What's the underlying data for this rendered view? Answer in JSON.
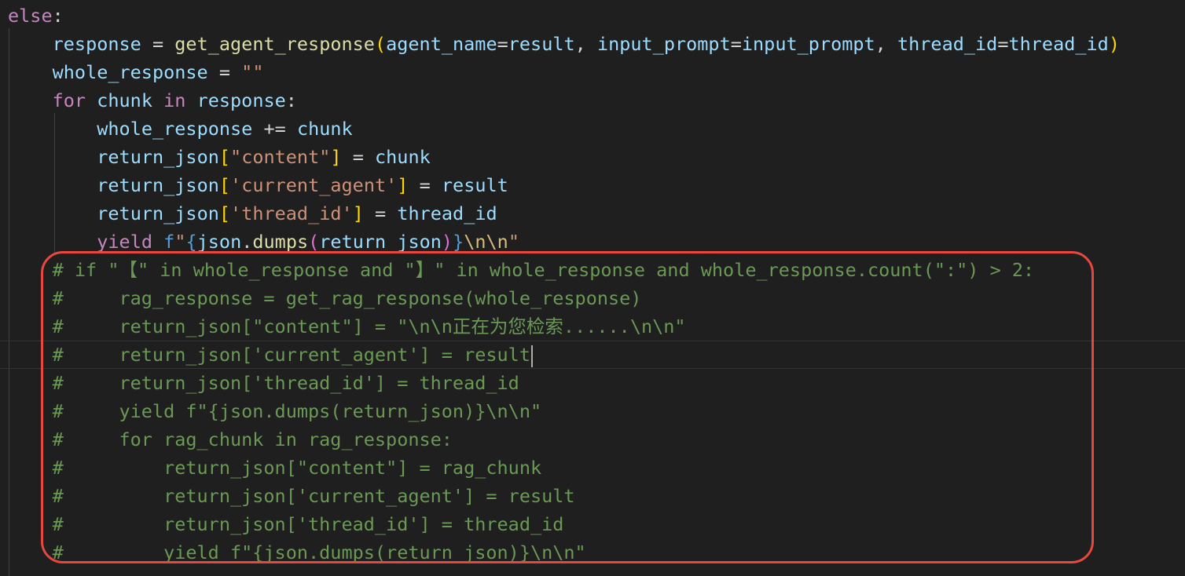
{
  "editor": {
    "language": "python",
    "theme": "dark",
    "cursor_line": 13,
    "lines": [
      "else:",
      "    response = get_agent_response(agent_name=result, input_prompt=input_prompt, thread_id=thread_id)",
      "    whole_response = \"\"",
      "    for chunk in response:",
      "        whole_response += chunk",
      "        return_json[\"content\"] = chunk",
      "        return_json['current_agent'] = result",
      "        return_json['thread_id'] = thread_id",
      "        yield f\"{json.dumps(return_json)}\\n\\n\"",
      "    # if \"【\" in whole_response and \"】\" in whole_response and whole_response.count(\":\") > 2:",
      "    #     rag_response = get_rag_response(whole_response)",
      "    #     return_json[\"content\"] = \"\\n\\n正在为您检索......\\n\\n\"",
      "    #     return_json['current_agent'] = result",
      "    #     return_json['thread_id'] = thread_id",
      "    #     yield f\"{json.dumps(return_json)}\\n\\n\"",
      "    #     for rag_chunk in rag_response:",
      "    #         return_json[\"content\"] = rag_chunk",
      "    #         return_json['current_agent'] = result",
      "    #         return_json['thread_id'] = thread_id",
      "    #         yield f\"{json.dumps(return_json)}\\n\\n\""
    ]
  },
  "annotation": {
    "color": "#e8473f",
    "shape": "rounded-rectangle"
  },
  "colors": {
    "background": "#1f1f1f",
    "keyword_control": "#c586c0",
    "variable": "#9cdcfe",
    "function": "#dcdcaa",
    "string": "#ce9178",
    "comment": "#6a9955",
    "bracket_level1": "#ffd700",
    "bracket_level2": "#da70d6",
    "bracket_level3": "#179fff",
    "escape": "#d7ba7d"
  }
}
